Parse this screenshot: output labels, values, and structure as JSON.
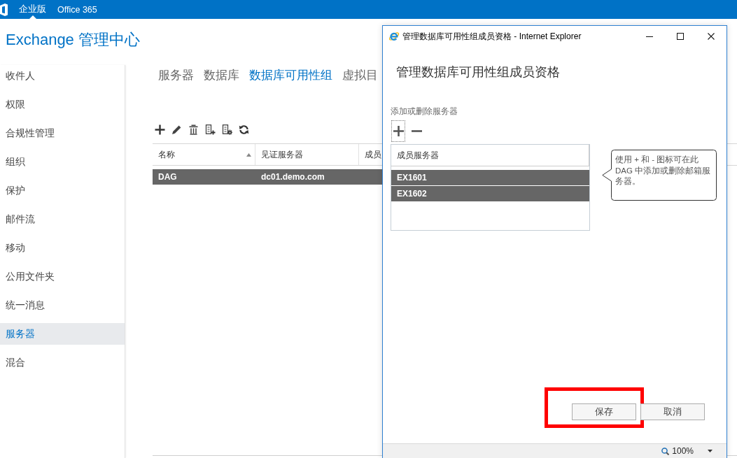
{
  "top_bar": {
    "items": [
      {
        "label": "企业版",
        "selected": true
      },
      {
        "label": "Office 365",
        "selected": false
      }
    ]
  },
  "app_title": "Exchange 管理中心",
  "sidebar": {
    "items": [
      {
        "label": "收件人",
        "selected": false
      },
      {
        "label": "权限",
        "selected": false
      },
      {
        "label": "合规性管理",
        "selected": false
      },
      {
        "label": "组织",
        "selected": false
      },
      {
        "label": "保护",
        "selected": false
      },
      {
        "label": "邮件流",
        "selected": false
      },
      {
        "label": "移动",
        "selected": false
      },
      {
        "label": "公用文件夹",
        "selected": false
      },
      {
        "label": "统一消息",
        "selected": false
      },
      {
        "label": "服务器",
        "selected": true
      },
      {
        "label": "混合",
        "selected": false
      }
    ]
  },
  "tabs": [
    {
      "label": "服务器",
      "selected": false
    },
    {
      "label": "数据库",
      "selected": false
    },
    {
      "label": "数据库可用性组",
      "selected": true
    },
    {
      "label": "虚拟目",
      "selected": false
    }
  ],
  "table": {
    "columns": [
      {
        "label": "名称",
        "sorted": true
      },
      {
        "label": "见证服务器",
        "sorted": false
      },
      {
        "label": "成员",
        "sorted": false
      }
    ],
    "rows": [
      {
        "cells": [
          "DAG",
          "dc01.demo.com"
        ],
        "selected": true
      }
    ]
  },
  "dialog": {
    "window_title": "管理数据库可用性组成员资格 - Internet Explorer",
    "heading": "管理数据库可用性组成员资格",
    "section_label": "添加或删除服务器",
    "member_actions": [
      {
        "kind": "add",
        "focused": true
      },
      {
        "kind": "remove",
        "focused": false
      }
    ],
    "member_list": {
      "column": "成员服务器",
      "rows": [
        {
          "label": "EX1601",
          "selected": true
        },
        {
          "label": "EX1602",
          "selected": true
        }
      ]
    },
    "help_text": "使用 + 和 - 图标可在此 DAG 中添加或删除邮箱服务器。",
    "buttons": [
      {
        "label": "保存",
        "highlighted": true
      },
      {
        "label": "取消",
        "highlighted": false
      }
    ],
    "status_bar": {
      "zoom": "100%"
    }
  }
}
